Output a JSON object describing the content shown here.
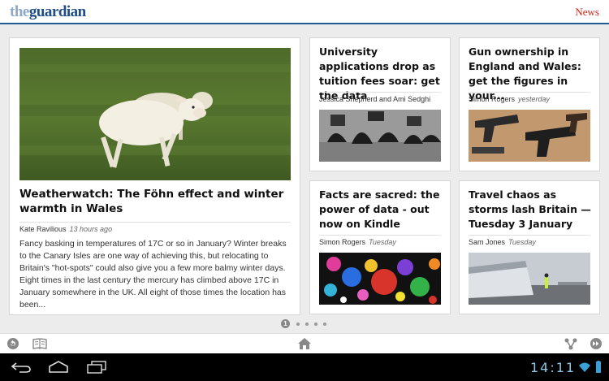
{
  "app": {
    "logo_prefix": "the",
    "logo_name": "guardian",
    "section": "News"
  },
  "feature": {
    "title": "Weatherwatch: The Föhn effect and winter warmth in Wales",
    "author": "Kate Ravilious",
    "time": "13 hours ago",
    "excerpt": "Fancy basking in temperatures of 17C or so in January? Winter breaks to the Canary Isles are one way of achieving this, but relocating to Britain's \"hot-spots\" could also give you a few more balmy winter days. Eight times in the last century the mercury has climbed above 17C in January somewhere in the UK. All eight of those times the location has been..."
  },
  "cards": [
    {
      "title": "University applications drop as tuition fees soar: get the data",
      "author": "Jessica Shepherd and Ami Sedghi",
      "time": ""
    },
    {
      "title": "Gun ownership in England and Wales: get the figures in your...",
      "author": "Simon Rogers",
      "time": "yesterday"
    },
    {
      "title": "Facts are sacred: the power of data - out now on Kindle",
      "author": "Simon Rogers",
      "time": "Tuesday"
    },
    {
      "title": "Travel chaos as storms lash Britain — Tuesday 3 January",
      "author": "Sam Jones",
      "time": "Tuesday"
    }
  ],
  "pager": {
    "current": "1"
  },
  "system": {
    "clock": "14:11"
  },
  "colors": {
    "brand_blue": "#1f5a93",
    "section_red": "#c9241a",
    "clock_blue": "#8fc8e6"
  },
  "icons": [
    "refresh-icon",
    "book-icon",
    "home-icon",
    "share-icon",
    "fast-forward-icon",
    "back-icon",
    "home-nav-icon",
    "recent-apps-icon",
    "wifi-icon"
  ]
}
